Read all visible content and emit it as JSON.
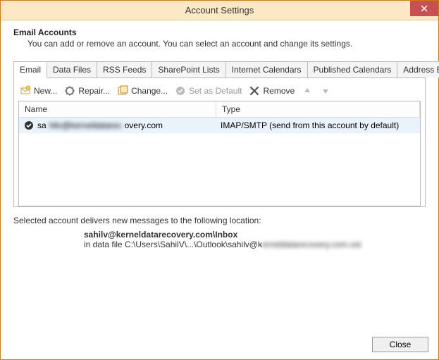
{
  "window": {
    "title": "Account Settings"
  },
  "header": {
    "title": "Email Accounts",
    "description": "You can add or remove an account. You can select an account and change its settings."
  },
  "tabs": {
    "items": [
      "Email",
      "Data Files",
      "RSS Feeds",
      "SharePoint Lists",
      "Internet Calendars",
      "Published Calendars",
      "Address Books"
    ],
    "active": 0
  },
  "toolbar": {
    "new": "New...",
    "repair": "Repair...",
    "change": "Change...",
    "set_default": "Set as Default",
    "remove": "Remove"
  },
  "table": {
    "columns": {
      "name": "Name",
      "type": "Type"
    },
    "rows": [
      {
        "name_prefix": "sa",
        "name_hidden": "hilv@kerneldatarec",
        "name_suffix": "overy.com",
        "type": "IMAP/SMTP (send from this account by default)"
      }
    ]
  },
  "delivery": {
    "label": "Selected account delivers new messages to the following location:",
    "inbox": "sahilv@kerneldatarecovery.com\\Inbox",
    "path_prefix": "in data file C:\\Users\\SahilV\\...\\Outlook\\sahilv@k",
    "path_hidden": "erneldatarecovery.com.ost"
  },
  "footer": {
    "close": "Close"
  }
}
